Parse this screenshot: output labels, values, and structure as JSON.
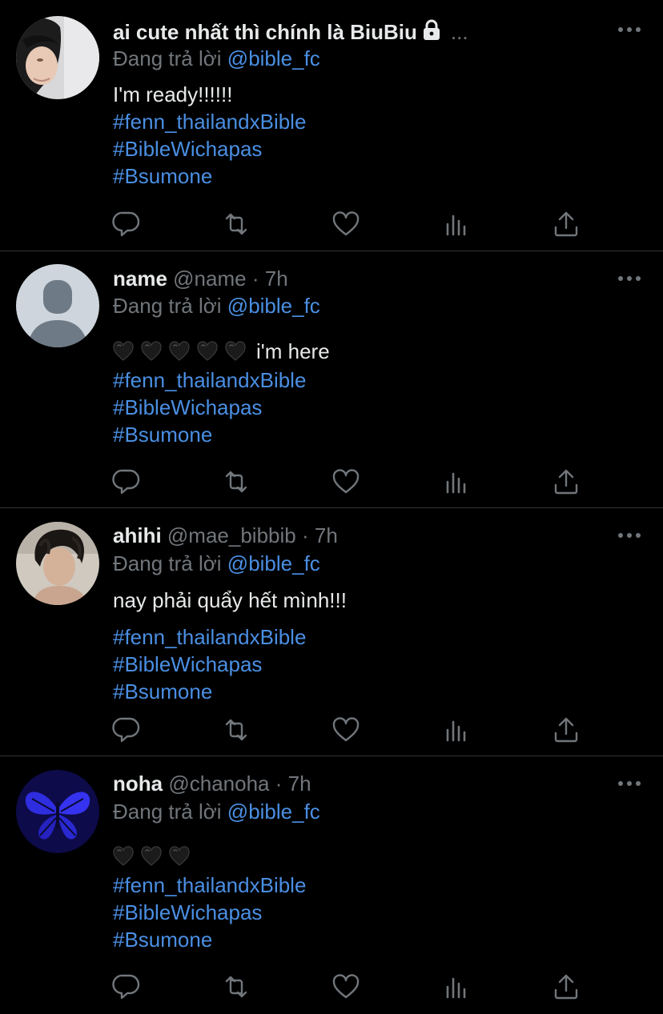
{
  "colors": {
    "background": "#000000",
    "text": "#e7e9ea",
    "muted": "#71767b",
    "link": "#4a8fe3",
    "divider": "#2f3336"
  },
  "reply_prefix": "Đang trả lời",
  "tweets": [
    {
      "display_name": "ai cute nhất thì chính là BiuBiu",
      "name_suffix": "...",
      "handle": "",
      "dot": "",
      "time": "",
      "reply_to": "@bible_fc",
      "text": "I'm ready!!!!!!",
      "hashtags": [
        "#fenn_thailandxBible",
        "#BibleWichapas",
        "#Bsumone"
      ],
      "avatar": "photo-person-light"
    },
    {
      "display_name": "name",
      "handle": "@name",
      "dot": "·",
      "time": "7h",
      "reply_to": "@bible_fc",
      "text": "i'm here",
      "hearts": 5,
      "hashtags": [
        "#fenn_thailandxBible",
        "#BibleWichapas",
        "#Bsumone"
      ],
      "avatar": "default-avatar"
    },
    {
      "display_name": "ahihi",
      "handle": "@mae_bibbib",
      "dot": "·",
      "time": "7h",
      "reply_to": "@bible_fc",
      "text": "nay phải quẩy hết mình!!!",
      "hashtags": [
        "#fenn_thailandxBible",
        "#BibleWichapas",
        "#Bsumone"
      ],
      "avatar": "photo-person-dark"
    },
    {
      "display_name": "noha",
      "handle": "@chanoha",
      "dot": "·",
      "time": "7h",
      "reply_to": "@bible_fc",
      "text": "",
      "hearts": 3,
      "hashtags": [
        "#fenn_thailandxBible",
        "#BibleWichapas",
        "#Bsumone"
      ],
      "avatar": "butterfly"
    }
  ],
  "actions": [
    "reply-icon",
    "retweet-icon",
    "like-icon",
    "analytics-icon",
    "share-icon"
  ]
}
